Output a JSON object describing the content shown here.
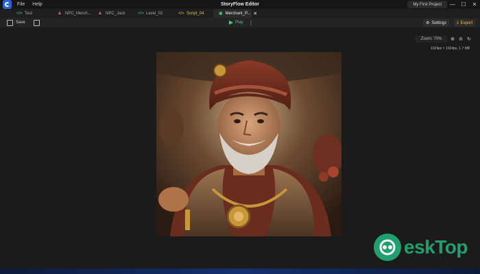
{
  "window": {
    "title": "StoryFlow Editor",
    "menu": [
      "File",
      "Help"
    ],
    "project": "My First Project",
    "controls": {
      "minimize": "—",
      "maximize": "☐",
      "close": "✕"
    }
  },
  "tabs": [
    {
      "label": "Test",
      "icon": "</>",
      "icon_name": "code-icon"
    },
    {
      "label": "NPC_Merch...",
      "icon": "♟",
      "icon_name": "character-icon"
    },
    {
      "label": "NPC_Jack",
      "icon": "♟",
      "icon_name": "character-icon"
    },
    {
      "label": "Level_02",
      "icon": "</>",
      "icon_name": "code-icon"
    },
    {
      "label": "Script_04",
      "icon": "</>",
      "icon_name": "code-icon"
    },
    {
      "label": "Merchant_P...",
      "icon": "▣",
      "icon_name": "image-icon",
      "close": "✕"
    }
  ],
  "toolbar": {
    "save_label": "Save",
    "play_label": "Play",
    "settings_label": "Settings",
    "export_label": "Export",
    "more": "⋮"
  },
  "viewer": {
    "zoom": "Zoom: 70%",
    "zoom_in": "⊕",
    "zoom_out": "⊖",
    "reset": "↻",
    "info": "1024px × 1024px, 1.7 MB"
  },
  "watermark": {
    "text": "eskTop"
  },
  "colors": {
    "accent_yellow": "#f0c040",
    "play_green": "#53c98a",
    "app_blue": "#2d62d6",
    "watermark_green": "#21a06f",
    "npc_icon": "#d9607a",
    "code_icon": "#4fc3a5",
    "image_tab_icon": "#53c98a"
  }
}
